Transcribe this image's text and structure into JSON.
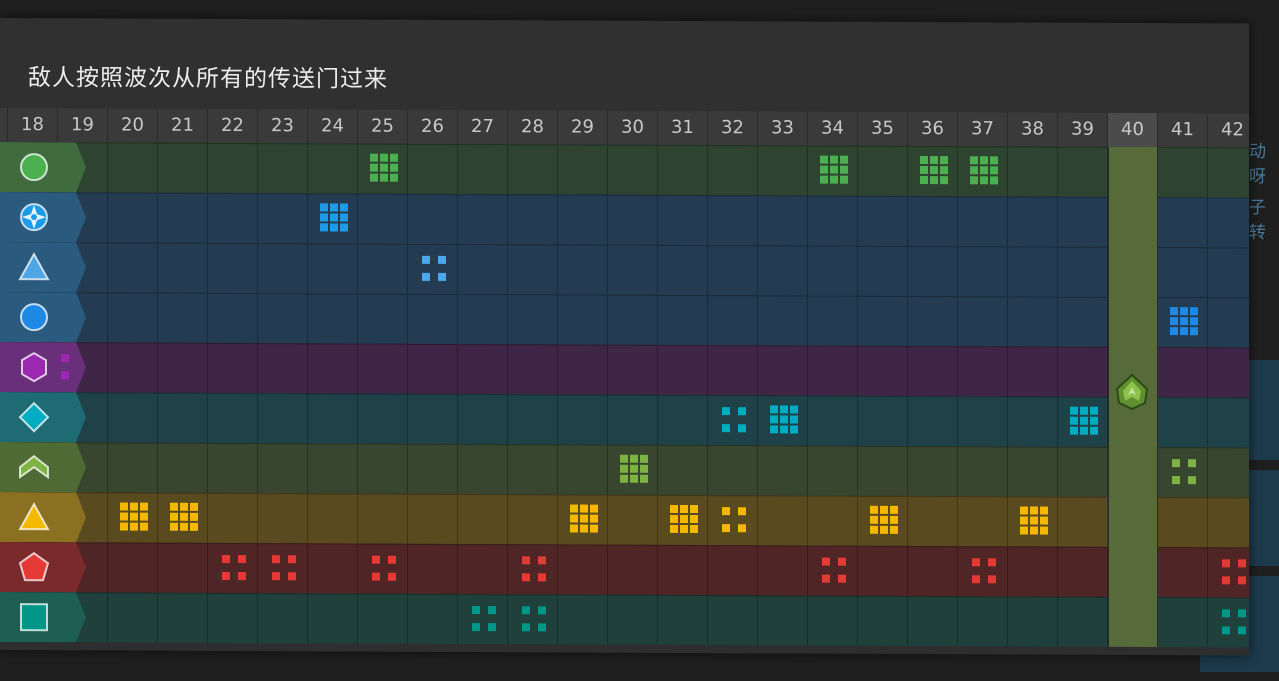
{
  "title": "敌人按照波次从所有的传送门过来",
  "background_fragments": [
    "动呀",
    "子转"
  ],
  "columns": [
    18,
    19,
    20,
    21,
    22,
    23,
    24,
    25,
    26,
    27,
    28,
    29,
    30,
    31,
    32,
    33,
    34,
    35,
    36,
    37,
    38,
    39,
    40,
    41,
    42
  ],
  "highlight_column": 40,
  "highlight_icon": "green-arrow-enemy-icon",
  "rows": [
    {
      "name": "green-circle",
      "icon": "circle-icon",
      "color": "#4caf50",
      "bg": "#2e4330",
      "portal_bg": "#3f6b3f",
      "waves": [
        {
          "col": 25,
          "n": 9
        },
        {
          "col": 34,
          "n": 9
        },
        {
          "col": 36,
          "n": 9
        },
        {
          "col": 37,
          "n": 9
        }
      ]
    },
    {
      "name": "blue-shuriken",
      "icon": "shuriken-icon",
      "color": "#1e9be8",
      "bg": "#233c52",
      "portal_bg": "#2a5a7e",
      "waves": [
        {
          "col": 24,
          "n": 9
        }
      ]
    },
    {
      "name": "lightblue-triangle",
      "icon": "triangle-icon",
      "color": "#4ea6e6",
      "bg": "#233c52",
      "portal_bg": "#2a5a7e",
      "waves": [
        {
          "col": 26,
          "n": 4
        }
      ]
    },
    {
      "name": "blue-circle",
      "icon": "circle-icon",
      "color": "#1e88e5",
      "bg": "#233c52",
      "portal_bg": "#2a5a7e",
      "waves": [
        {
          "col": 41,
          "n": 9
        }
      ]
    },
    {
      "name": "purple-hexagon",
      "icon": "hexagon-icon",
      "color": "#9c27b0",
      "bg": "#3f2546",
      "portal_bg": "#6a2f7a",
      "waves": [
        {
          "col": 19,
          "n": 2
        }
      ]
    },
    {
      "name": "cyan-diamond",
      "icon": "diamond-icon",
      "color": "#00acc1",
      "bg": "#1f4249",
      "portal_bg": "#1f6b74",
      "waves": [
        {
          "col": 32,
          "n": 4
        },
        {
          "col": 33,
          "n": 9
        },
        {
          "col": 39,
          "n": 9
        }
      ]
    },
    {
      "name": "lime-chevron",
      "icon": "chevron-up-icon",
      "color": "#7cb342",
      "bg": "#38452f",
      "portal_bg": "#4f6a35",
      "waves": [
        {
          "col": 30,
          "n": 9
        },
        {
          "col": 41,
          "n": 4
        }
      ]
    },
    {
      "name": "yellow-triangle",
      "icon": "triangle-icon",
      "color": "#f5b800",
      "bg": "#5a4a1f",
      "portal_bg": "#8a7020",
      "waves": [
        {
          "col": 20,
          "n": 9
        },
        {
          "col": 21,
          "n": 9
        },
        {
          "col": 29,
          "n": 9
        },
        {
          "col": 31,
          "n": 9
        },
        {
          "col": 32,
          "n": 4
        },
        {
          "col": 35,
          "n": 9
        },
        {
          "col": 38,
          "n": 9
        }
      ]
    },
    {
      "name": "red-pentagon",
      "icon": "pentagon-icon",
      "color": "#e53935",
      "bg": "#502525",
      "portal_bg": "#7a2a2a",
      "waves": [
        {
          "col": 22,
          "n": 4
        },
        {
          "col": 23,
          "n": 4
        },
        {
          "col": 25,
          "n": 4
        },
        {
          "col": 28,
          "n": 4
        },
        {
          "col": 34,
          "n": 4
        },
        {
          "col": 37,
          "n": 4
        },
        {
          "col": 42,
          "n": 4
        }
      ]
    },
    {
      "name": "teal-square",
      "icon": "square-icon",
      "color": "#009688",
      "bg": "#1f403b",
      "portal_bg": "#1d5e55",
      "waves": [
        {
          "col": 27,
          "n": 4
        },
        {
          "col": 28,
          "n": 4
        },
        {
          "col": 42,
          "n": 4
        }
      ]
    }
  ]
}
